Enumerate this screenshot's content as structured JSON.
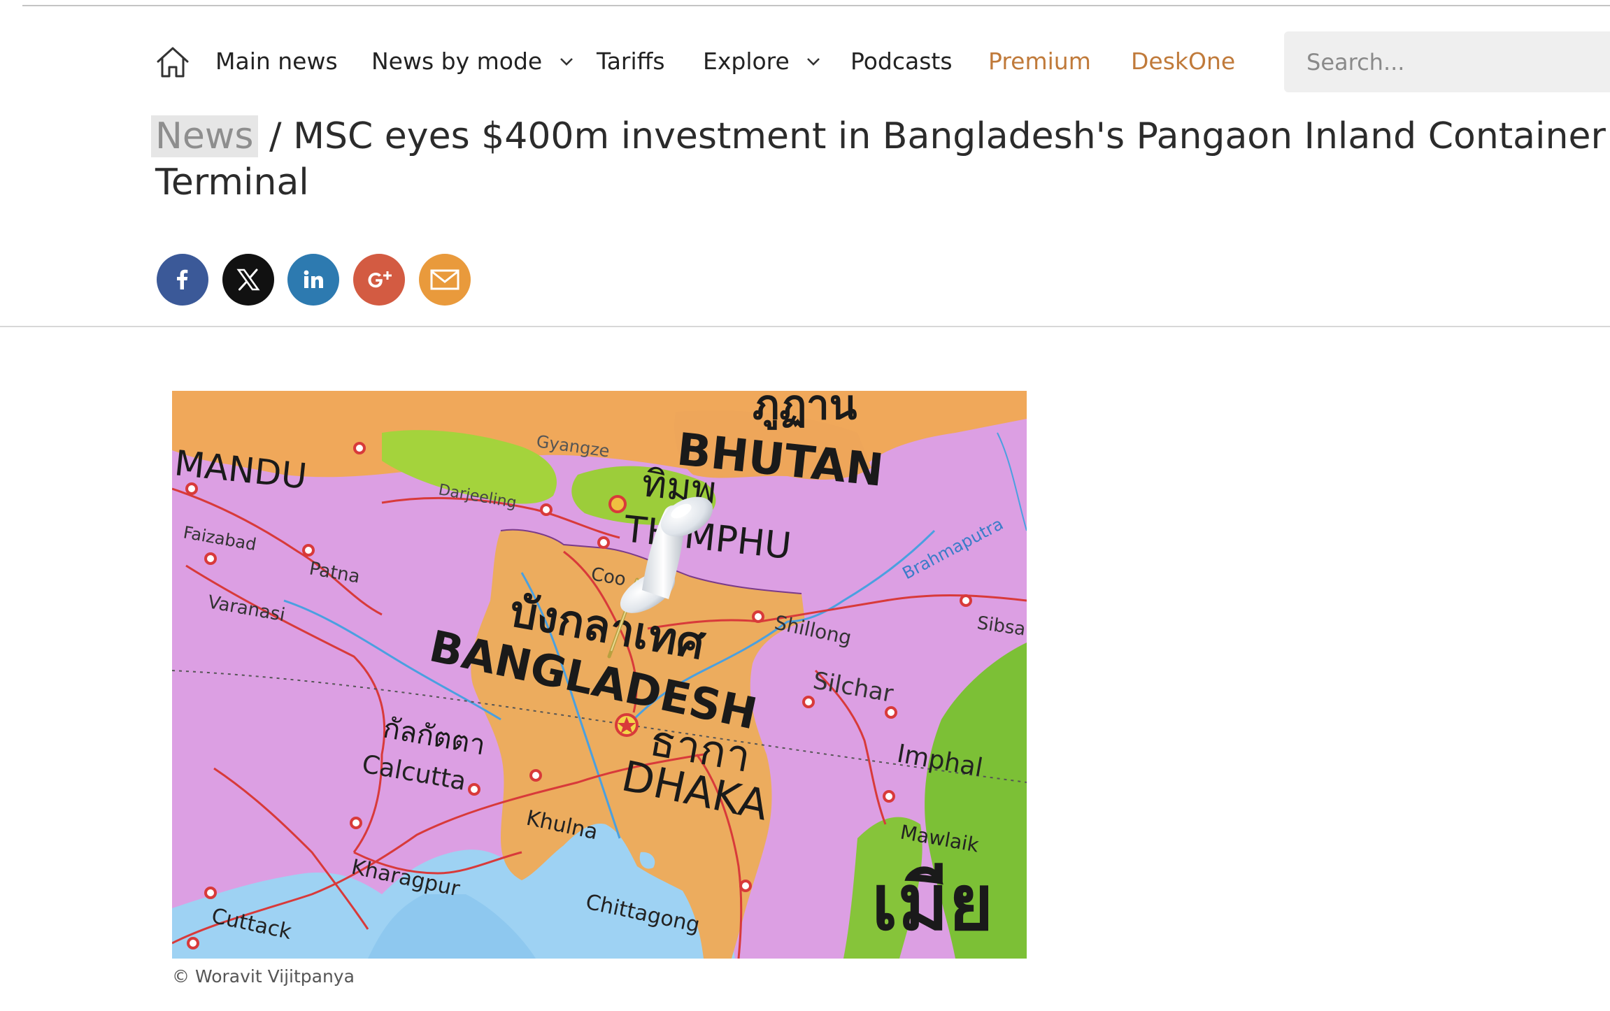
{
  "nav": {
    "home_icon": "home-icon",
    "items": [
      {
        "label": "Main news"
      },
      {
        "label": "News by mode",
        "icon": "chevron-down-icon"
      },
      {
        "label": "Tariffs"
      },
      {
        "label": "Explore",
        "icon": "chevron-down-icon"
      },
      {
        "label": "Podcasts"
      },
      {
        "label": "Premium",
        "color": "#c07a3a"
      },
      {
        "label": "DeskOne",
        "color": "#c07a3a"
      }
    ],
    "search_placeholder": "Search..."
  },
  "article": {
    "breadcrumb": "News",
    "separator": " / ",
    "title": "MSC eyes $400m investment in Bangladesh's Pangaon Inland Container Terminal"
  },
  "share": [
    {
      "icon": "facebook-icon",
      "color": "#3b5998"
    },
    {
      "icon": "x-icon",
      "color": "#111111"
    },
    {
      "icon": "linkedin-icon",
      "color": "#2d7ab0"
    },
    {
      "icon": "google-plus-icon",
      "color": "#d35b42"
    },
    {
      "icon": "email-icon",
      "color": "#e99a3c"
    }
  ],
  "hero": {
    "map_labels": {
      "bhutan_th": "ภูฏาน",
      "bhutan": "BHUTAN",
      "thimphu_th": "ทิมพู",
      "thimphu": "THIMPHU",
      "kathmandu": "MANDU",
      "gyangze": "Gyangze",
      "darjeeling": "Darjeeling",
      "faizabad": "Faizabad",
      "patna": "Patna",
      "varanasi": "Varanasi",
      "bangladesh_th": "บังกลาเทศ",
      "bangladesh": "BANGLADESH",
      "cooch": "Coo",
      "shillong": "Shillong",
      "silchar": "Silchar",
      "calcutta_th": "กัลกัตตา",
      "calcutta": "Calcutta",
      "dhaka_th": "ธากา",
      "dhaka": "DHAKA",
      "imphal": "Imphal",
      "khulna": "Khulna",
      "kharagpur": "Kharagpur",
      "cuttack": "Cuttack",
      "chittagong": "Chittagong",
      "mawlaik": "Mawlaik",
      "sibsagar": "Sibsa",
      "river": "Brahmaputra",
      "myanmar_th": "เมีย"
    },
    "caption": "© Woravit Vijitpanya"
  }
}
